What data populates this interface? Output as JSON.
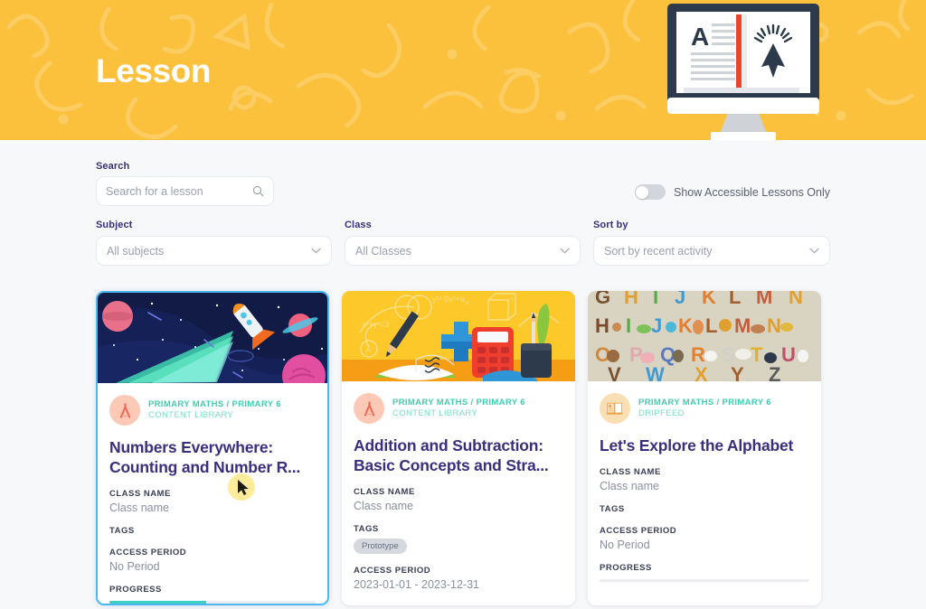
{
  "banner": {
    "title": "Lesson",
    "bg_color": "#fbc13d",
    "illustration": "computer-monitor-open-book-cursor"
  },
  "search": {
    "label": "Search",
    "placeholder": "Search for a lesson",
    "value": "",
    "icon": "search-icon"
  },
  "accessible_toggle": {
    "label": "Show Accessible Lessons Only",
    "state": "off"
  },
  "filters": [
    {
      "label": "Subject",
      "value": "All subjects",
      "icon": "chevron-down-icon"
    },
    {
      "label": "Class",
      "value": "All Classes",
      "icon": "chevron-down-icon"
    },
    {
      "label": "Sort by",
      "value": "Sort by recent activity",
      "icon": "chevron-down-icon"
    }
  ],
  "labels": {
    "class_name": "CLASS NAME",
    "tags": "TAGS",
    "access_period": "ACCESS PERIOD",
    "progress": "PROGRESS"
  },
  "cards": [
    {
      "thumbnail": "space-rocket-planets-illustration",
      "avatar_icon": "compass-icon",
      "course": "PRIMARY MATHS / PRIMARY 6",
      "source": "CONTENT LIBRARY",
      "title": "Numbers Everywhere: Counting and Number R...",
      "class_name": "Class name",
      "tags": [],
      "access_period": "No Period",
      "progress_percent": 47,
      "selected": true
    },
    {
      "thumbnail": "math-desk-calculator-notebook-illustration",
      "avatar_icon": "compass-icon",
      "course": "PRIMARY MATHS / PRIMARY 6",
      "source": "CONTENT LIBRARY",
      "title": "Addition and Subtraction: Basic Concepts and Stra...",
      "class_name": "Class name",
      "tags": [
        "Prototype"
      ],
      "access_period": "2023-01-01 - 2023-12-31",
      "progress_percent": null,
      "selected": false
    },
    {
      "thumbnail": "animal-alphabet-illustration",
      "avatar_icon": "open-book-icon",
      "course": "PRIMARY MATHS / PRIMARY 6",
      "source": "DRIPFEED",
      "title": "Let's Explore the Alphabet",
      "class_name": "Class name",
      "tags": [],
      "access_period": "No Period",
      "progress_percent": 0,
      "selected": false
    }
  ],
  "colors": {
    "banner": "#fbc13d",
    "page_bg": "#f7f8fa",
    "heading": "#3b2e7e",
    "accent_teal": "#3ecfb0",
    "selected_border": "#4db8f0",
    "progress": "#3ecfc4"
  }
}
